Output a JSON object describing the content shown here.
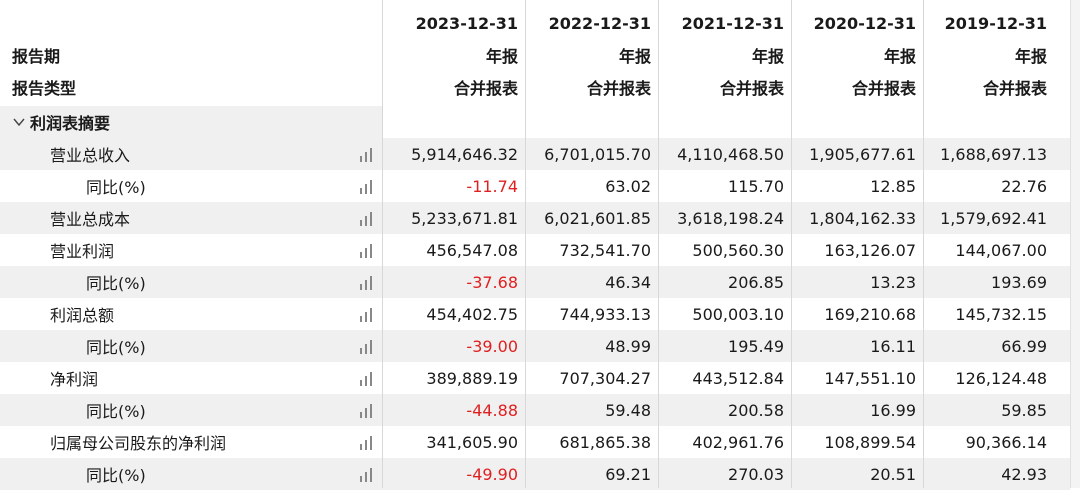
{
  "header": {
    "dates": [
      "2023-12-31",
      "2022-12-31",
      "2021-12-31",
      "2020-12-31",
      "2019-12-31"
    ],
    "period_label": "报告期",
    "period_values": [
      "年报",
      "年报",
      "年报",
      "年报",
      "年报"
    ],
    "type_label": "报告类型",
    "type_values": [
      "合并报表",
      "合并报表",
      "合并报表",
      "合并报表",
      "合并报表"
    ]
  },
  "section": {
    "title": "利润表摘要"
  },
  "rows": [
    {
      "label": "营业总收入",
      "values": [
        "5,914,646.32",
        "6,701,015.70",
        "4,110,468.50",
        "1,905,677.61",
        "1,688,697.13"
      ]
    },
    {
      "label": "同比(%)",
      "values": [
        "-11.74",
        "63.02",
        "115.70",
        "12.85",
        "22.76"
      ]
    },
    {
      "label": "营业总成本",
      "values": [
        "5,233,671.81",
        "6,021,601.85",
        "3,618,198.24",
        "1,804,162.33",
        "1,579,692.41"
      ]
    },
    {
      "label": "营业利润",
      "values": [
        "456,547.08",
        "732,541.70",
        "500,560.30",
        "163,126.07",
        "144,067.00"
      ]
    },
    {
      "label": "同比(%)",
      "values": [
        "-37.68",
        "46.34",
        "206.85",
        "13.23",
        "193.69"
      ]
    },
    {
      "label": "利润总额",
      "values": [
        "454,402.75",
        "744,933.13",
        "500,003.10",
        "169,210.68",
        "145,732.15"
      ]
    },
    {
      "label": "同比(%)",
      "values": [
        "-39.00",
        "48.99",
        "195.49",
        "16.11",
        "66.99"
      ]
    },
    {
      "label": "净利润",
      "values": [
        "389,889.19",
        "707,304.27",
        "443,512.84",
        "147,551.10",
        "126,124.48"
      ]
    },
    {
      "label": "同比(%)",
      "values": [
        "-44.88",
        "59.48",
        "200.58",
        "16.99",
        "59.85"
      ]
    },
    {
      "label": "归属母公司股东的净利润",
      "values": [
        "341,605.90",
        "681,865.38",
        "402,961.76",
        "108,899.54",
        "90,366.14"
      ]
    },
    {
      "label": "同比(%)",
      "values": [
        "-49.90",
        "69.21",
        "270.03",
        "20.51",
        "42.93"
      ]
    }
  ],
  "colors": {
    "negative": "#e02020",
    "alt_row": "#f0f0f0",
    "chart_icon": "#888888"
  }
}
